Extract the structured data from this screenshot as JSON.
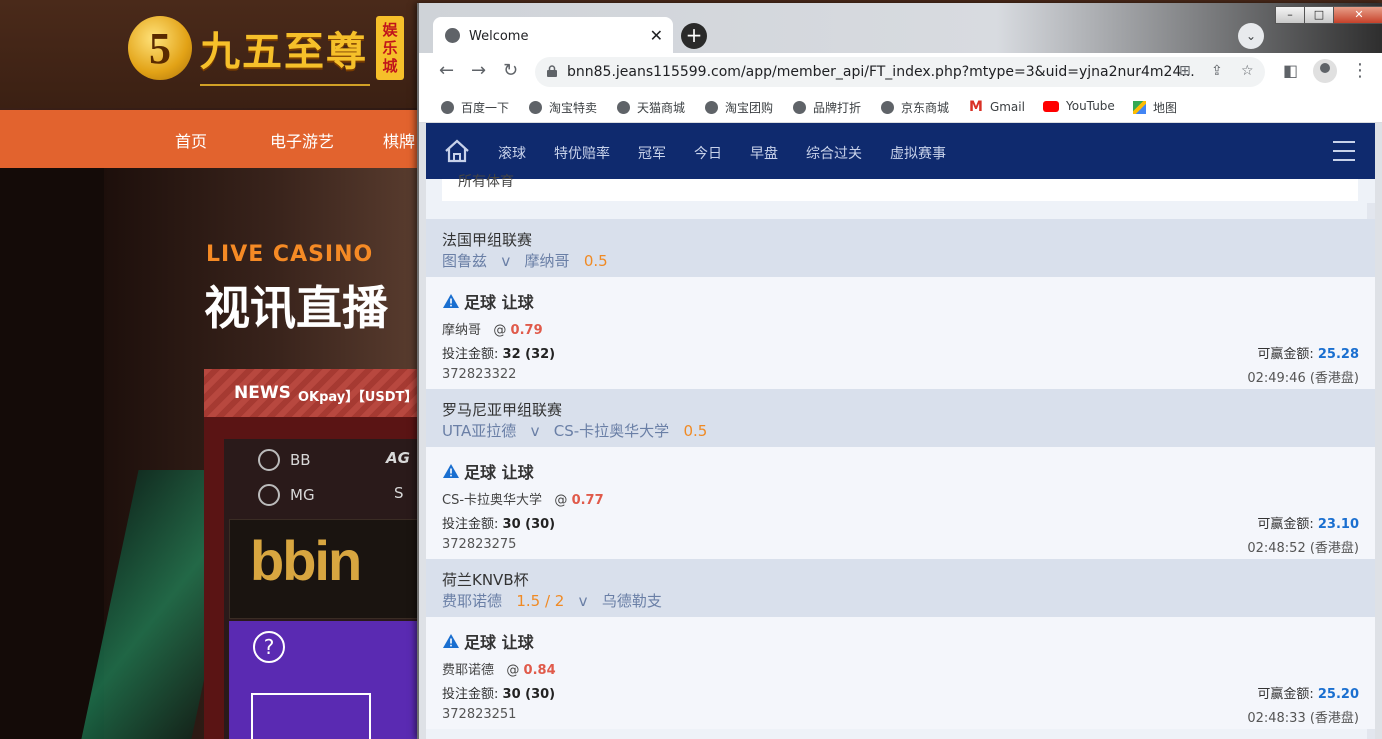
{
  "background_site": {
    "logo_digit": "5",
    "logo_text": "九五至尊",
    "logo_badge": [
      "娱",
      "乐",
      "城"
    ],
    "nav": [
      "首页",
      "电子游艺",
      "棋牌"
    ],
    "live_label": "LIVE CASINO",
    "video_title": "视讯直播",
    "news_label": "NEWS",
    "news_ticker": "OKpay】【USDT】",
    "providers": [
      "BB",
      "MG"
    ],
    "provider_logos": [
      "AG",
      "S"
    ],
    "bbin_logo": "bbin",
    "help_glyph": "?"
  },
  "browser": {
    "tab_title": "Welcome",
    "tab_close": "✕",
    "new_tab": "+",
    "tab_search": "⌄",
    "window_controls": [
      "–",
      "□",
      "✕"
    ],
    "url": "bnn85.jeans115599.com/app/member_api/FT_index.php?mtype=3&uid=yjna2nur4m24...",
    "bookmarks": [
      "百度一下",
      "淘宝特卖",
      "天猫商城",
      "淘宝团购",
      "品牌打折",
      "京东商城",
      "Gmail",
      "YouTube",
      "地图"
    ]
  },
  "site": {
    "nav": [
      "滚球",
      "特优赔率",
      "冠军",
      "今日",
      "早盘",
      "综合过关",
      "虚拟赛事"
    ],
    "filter_label": "所有体育"
  },
  "bets": [
    {
      "league": "法国甲组联赛",
      "home": "图鲁兹",
      "vs": "v",
      "away": "摩纳哥",
      "handicap": "0.5",
      "handicap_position": "after_away",
      "title": "足球 让球",
      "pick": "摩纳哥",
      "odds": "0.79",
      "amount_label": "投注金额:",
      "amount": "32 (32)",
      "ticket_id": "372823322",
      "win_label": "可赢金额:",
      "win": "25.28",
      "time": "02:49:46 (香港盘)"
    },
    {
      "league": "罗马尼亚甲组联赛",
      "home": "UTA亚拉德",
      "vs": "v",
      "away": "CS-卡拉奥华大学",
      "handicap": "0.5",
      "handicap_position": "after_away",
      "title": "足球 让球",
      "pick": "CS-卡拉奥华大学",
      "odds": "0.77",
      "amount_label": "投注金额:",
      "amount": "30 (30)",
      "ticket_id": "372823275",
      "win_label": "可赢金额:",
      "win": "23.10",
      "time": "02:48:52 (香港盘)"
    },
    {
      "league": "荷兰KNVB杯",
      "home": "费耶诺德",
      "vs": "v",
      "away": "乌德勒支",
      "handicap": "1.5 / 2",
      "handicap_position": "after_home",
      "title": "足球 让球",
      "pick": "费耶诺德",
      "odds": "0.84",
      "amount_label": "投注金额:",
      "amount": "30 (30)",
      "ticket_id": "372823251",
      "win_label": "可赢金额:",
      "win": "25.20",
      "time": "02:48:33 (香港盘)"
    }
  ],
  "colors": {
    "site_nav_bg": "#0f2a6e",
    "handicap": "#f08a24",
    "odds": "#e05a4a",
    "win_amount": "#1a6fd0",
    "bg_nav": "#e2632e"
  }
}
